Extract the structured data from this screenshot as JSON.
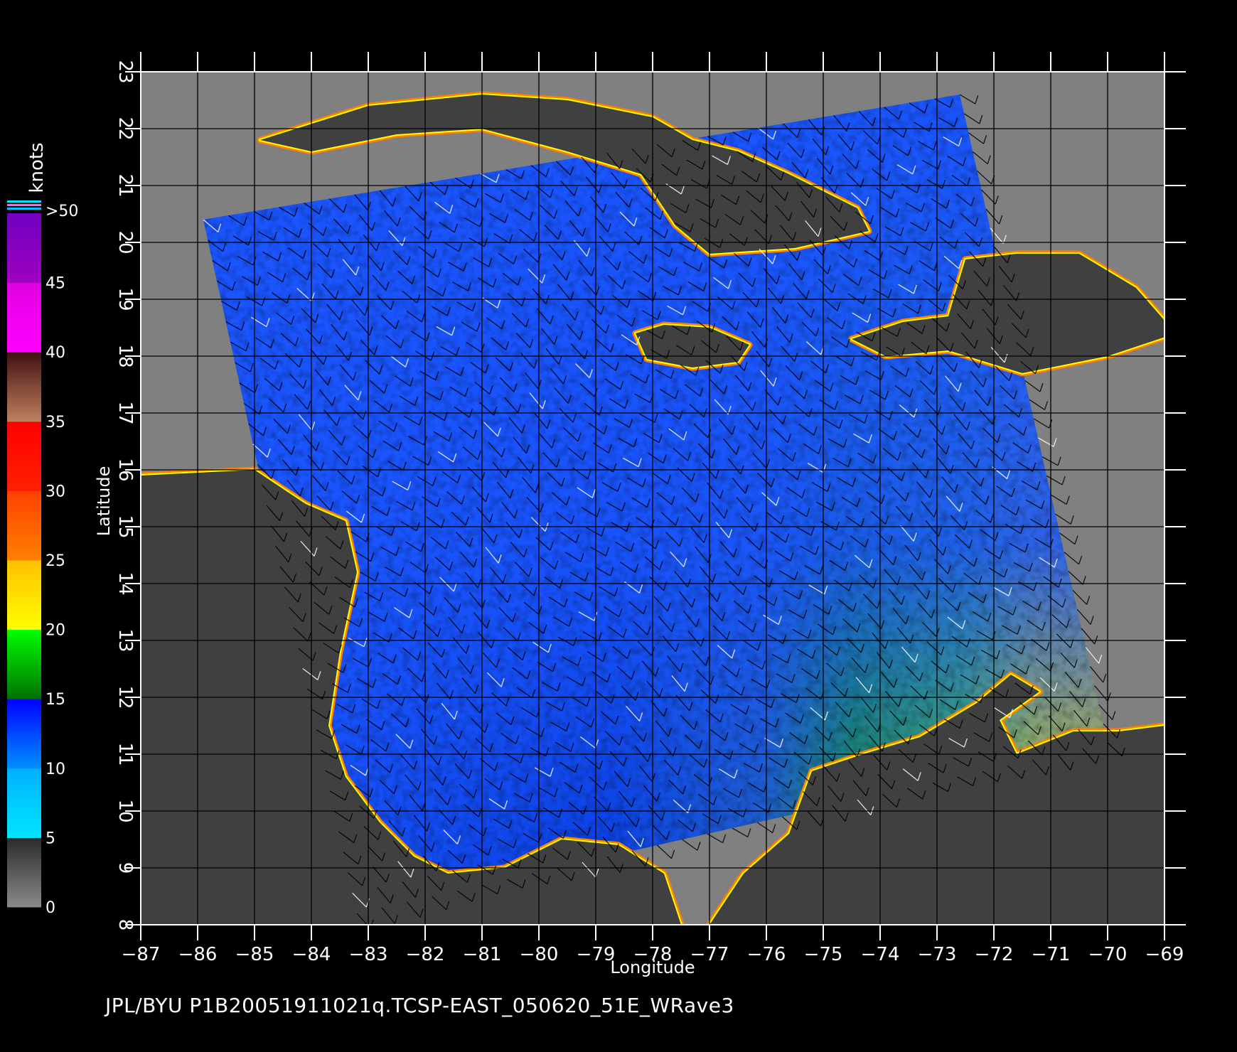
{
  "chart_data": {
    "type": "heatmap",
    "title": "",
    "xlabel": "Longitude",
    "ylabel": "Latitude",
    "xlim": [
      -87,
      -69
    ],
    "ylim": [
      8,
      23
    ],
    "x_ticks": [
      -87,
      -86,
      -85,
      -84,
      -83,
      -82,
      -81,
      -80,
      -79,
      -78,
      -77,
      -76,
      -75,
      -74,
      -73,
      -72,
      -71,
      -70,
      -69
    ],
    "y_ticks": [
      8,
      9,
      10,
      11,
      12,
      13,
      14,
      15,
      16,
      17,
      18,
      19,
      20,
      21,
      22,
      23
    ],
    "grid": true,
    "colorbar": {
      "title": "knots",
      "ticks": [
        "0",
        "5",
        "10",
        "15",
        "20",
        "25",
        "30",
        "35",
        "40",
        "45",
        ">50"
      ],
      "bands": [
        {
          "from": 0,
          "to": 5,
          "colors": [
            "#8a8a8a",
            "#2a2a2a"
          ]
        },
        {
          "from": 5,
          "to": 10,
          "colors": [
            "#00e6ff",
            "#00b0ff"
          ]
        },
        {
          "from": 10,
          "to": 15,
          "colors": [
            "#0090ff",
            "#0000ff"
          ]
        },
        {
          "from": 15,
          "to": 20,
          "colors": [
            "#007000",
            "#00ff00"
          ]
        },
        {
          "from": 20,
          "to": 25,
          "colors": [
            "#ffff00",
            "#ffc000"
          ]
        },
        {
          "from": 25,
          "to": 30,
          "colors": [
            "#ff8000",
            "#ff4000"
          ]
        },
        {
          "from": 30,
          "to": 35,
          "colors": [
            "#ff2000",
            "#ff0000"
          ]
        },
        {
          "from": 35,
          "to": 40,
          "colors": [
            "#c08060",
            "#401010"
          ]
        },
        {
          "from": 40,
          "to": 45,
          "colors": [
            "#ff00ff",
            "#e000e0"
          ]
        },
        {
          "from": 45,
          "to": 50,
          "colors": [
            "#a000c0",
            "#7000c0"
          ]
        }
      ]
    },
    "swath_corners": [
      [
        -85.9,
        20.4
      ],
      [
        -72.6,
        22.6
      ],
      [
        -70.0,
        11.2
      ],
      [
        -83.2,
        8.2
      ]
    ],
    "data_mask_corners": [
      [
        -85.0,
        16.0
      ],
      [
        -72.0,
        17.5
      ],
      [
        -70.3,
        11.1
      ],
      [
        -83.2,
        8.3
      ]
    ],
    "land_regions": [
      {
        "name": "Cuba",
        "outline": [
          [
            -84.9,
            21.8
          ],
          [
            -83.0,
            22.4
          ],
          [
            -81.0,
            22.6
          ],
          [
            -79.5,
            22.5
          ],
          [
            -78.0,
            22.2
          ],
          [
            -77.3,
            21.8
          ],
          [
            -76.5,
            21.6
          ],
          [
            -75.6,
            21.2
          ],
          [
            -74.4,
            20.6
          ],
          [
            -74.2,
            20.2
          ],
          [
            -75.5,
            19.9
          ],
          [
            -77.0,
            19.8
          ],
          [
            -77.6,
            20.3
          ],
          [
            -78.2,
            21.2
          ],
          [
            -79.5,
            21.6
          ],
          [
            -81.0,
            22.0
          ],
          [
            -82.5,
            21.9
          ],
          [
            -84.0,
            21.6
          ]
        ]
      },
      {
        "name": "Jamaica",
        "outline": [
          [
            -78.3,
            18.4
          ],
          [
            -77.8,
            18.55
          ],
          [
            -77.0,
            18.5
          ],
          [
            -76.3,
            18.2
          ],
          [
            -76.5,
            17.9
          ],
          [
            -77.3,
            17.8
          ],
          [
            -78.1,
            17.95
          ]
        ]
      },
      {
        "name": "Hispaniola",
        "outline": [
          [
            -74.5,
            18.3
          ],
          [
            -73.6,
            18.6
          ],
          [
            -72.8,
            18.7
          ],
          [
            -72.5,
            19.7
          ],
          [
            -71.6,
            19.8
          ],
          [
            -70.5,
            19.8
          ],
          [
            -69.5,
            19.2
          ],
          [
            -68.8,
            18.4
          ],
          [
            -70.0,
            18.0
          ],
          [
            -71.5,
            17.7
          ],
          [
            -72.8,
            18.1
          ],
          [
            -73.9,
            18.0
          ]
        ]
      },
      {
        "name": "Central America",
        "outline": [
          [
            -87,
            15.9
          ],
          [
            -85.0,
            16.0
          ],
          [
            -84.1,
            15.4
          ],
          [
            -83.4,
            15.1
          ],
          [
            -83.2,
            14.2
          ],
          [
            -83.5,
            12.8
          ],
          [
            -83.7,
            11.5
          ],
          [
            -83.4,
            10.6
          ],
          [
            -82.8,
            9.8
          ],
          [
            -82.2,
            9.2
          ],
          [
            -81.6,
            8.9
          ],
          [
            -80.6,
            9.0
          ],
          [
            -79.6,
            9.5
          ],
          [
            -78.6,
            9.4
          ],
          [
            -77.8,
            8.9
          ],
          [
            -77.5,
            8.0
          ],
          [
            -87,
            8.0
          ]
        ]
      },
      {
        "name": "South America",
        "outline": [
          [
            -77.0,
            8.0
          ],
          [
            -76.4,
            8.9
          ],
          [
            -75.6,
            9.6
          ],
          [
            -75.2,
            10.7
          ],
          [
            -74.3,
            11.0
          ],
          [
            -73.3,
            11.3
          ],
          [
            -72.3,
            11.9
          ],
          [
            -71.7,
            12.4
          ],
          [
            -71.2,
            12.1
          ],
          [
            -71.9,
            11.6
          ],
          [
            -71.6,
            11.0
          ],
          [
            -70.6,
            11.4
          ],
          [
            -69.8,
            11.4
          ],
          [
            -69.0,
            11.5
          ],
          [
            -69.0,
            8.0
          ]
        ]
      }
    ]
  },
  "footer": "JPL/BYU  P1B20051911021q.TCSP-EAST_050620_51E_WRave3"
}
